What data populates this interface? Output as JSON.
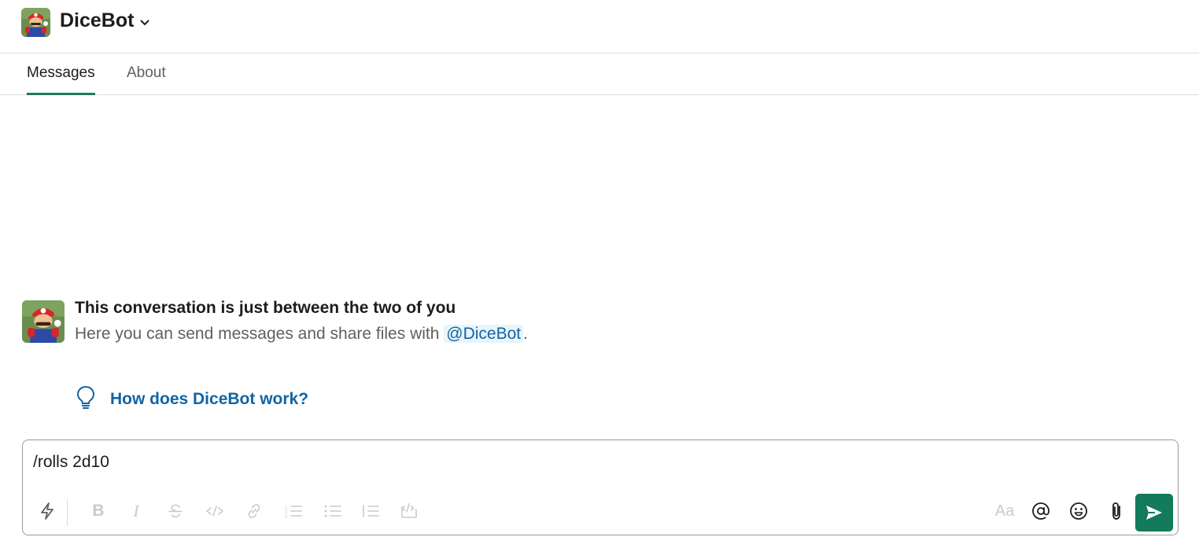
{
  "header": {
    "title": "DiceBot",
    "avatar_icon": "mario-avatar"
  },
  "tabs": [
    {
      "label": "Messages",
      "active": true
    },
    {
      "label": "About",
      "active": false
    }
  ],
  "intro": {
    "title": "This conversation is just between the two of you",
    "subtitle_prefix": "Here you can send messages and share files with ",
    "mention": "@DiceBot",
    "subtitle_suffix": "."
  },
  "help_link": {
    "icon": "lightbulb-icon",
    "label": "How does DiceBot work?"
  },
  "composer": {
    "value": "/rolls 2d10",
    "format_label": "Aa"
  },
  "colors": {
    "accent": "#137a5c",
    "link": "#1264a3",
    "mention_bg": "#e8f5fa"
  }
}
